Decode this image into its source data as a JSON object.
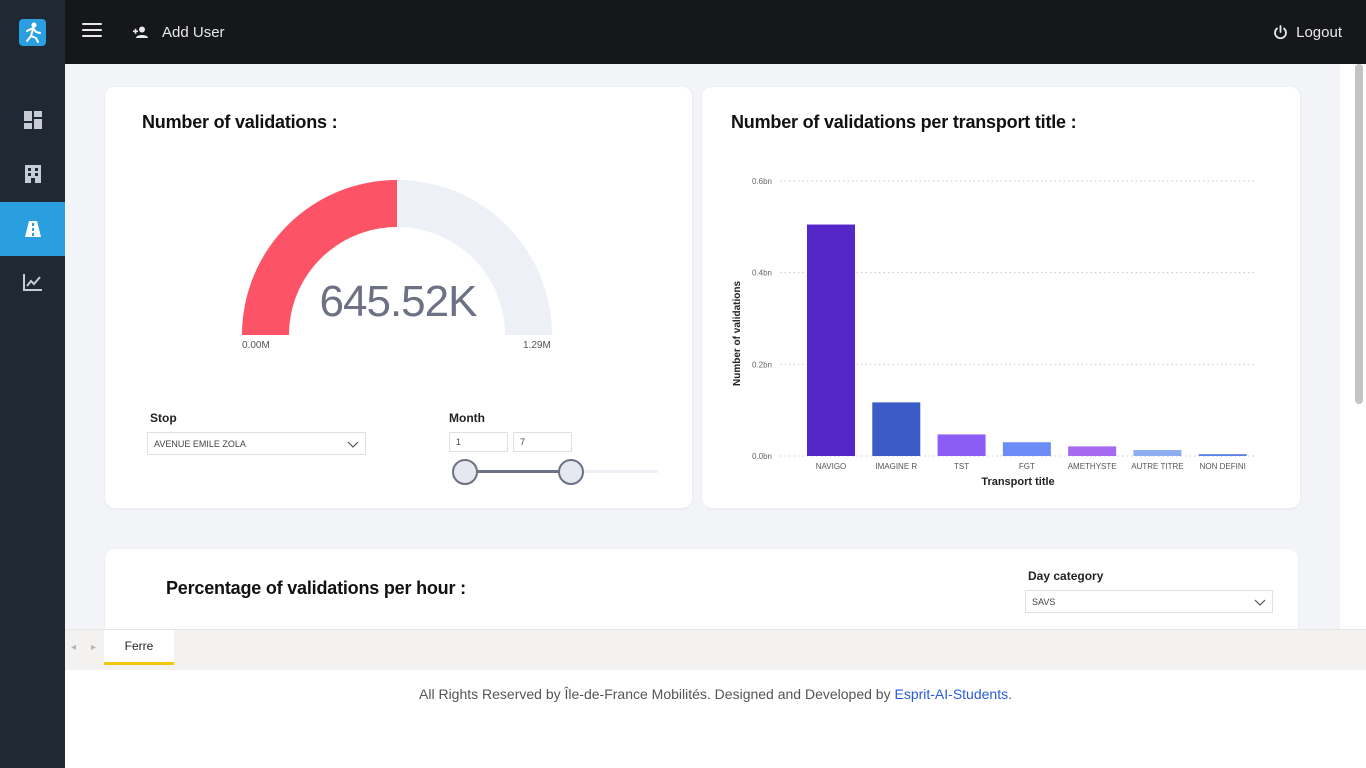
{
  "topbar": {
    "add_user_label": "Add User",
    "logout_label": "Logout"
  },
  "sidebar": {
    "items": [
      {
        "icon": "dashboard-icon",
        "active": false
      },
      {
        "icon": "building-icon",
        "active": false
      },
      {
        "icon": "road-icon",
        "active": true
      },
      {
        "icon": "line-chart-icon",
        "active": false
      }
    ]
  },
  "gauge_card": {
    "title": "Number of validations :",
    "value": "645.52K",
    "min_label": "0.00M",
    "max_label": "1.29M",
    "fill_fraction": 0.5,
    "fill_color": "#fd5366",
    "track_color": "#edf0f7",
    "stop_label": "Stop",
    "stop_value": "AVENUE EMILE ZOLA",
    "month_label": "Month",
    "month_from": "1",
    "month_to": "7"
  },
  "chart_card": {
    "title": "Number of validations per transport title :"
  },
  "chart_data": {
    "type": "bar",
    "xlabel": "Transport title",
    "ylabel": "Number of validations",
    "categories": [
      "NAVIGO",
      "IMAGINE R",
      "TST",
      "FGT",
      "AMETHYSTE",
      "AUTRE TITRE",
      "NON DEFINI"
    ],
    "values": [
      0.505,
      0.117,
      0.047,
      0.03,
      0.021,
      0.013,
      0.004
    ],
    "colors": [
      "#5527c8",
      "#3b5bc6",
      "#8b5cf6",
      "#6b8df5",
      "#a56af0",
      "#8eaef4",
      "#5b7fe8"
    ],
    "ylim": [
      0,
      0.6
    ],
    "yticks": [
      "0.0bn",
      "0.2bn",
      "0.4bn",
      "0.6bn"
    ],
    "grid": true
  },
  "hour_card": {
    "title": "Percentage of validations per hour :",
    "day_label": "Day category",
    "day_value": "SAVS"
  },
  "tabs": {
    "page_tab": "Ferre"
  },
  "footer": {
    "text_before": "All Rights Reserved by Île-de-France Mobilités. Designed and Developed by ",
    "link_text": "Esprit-AI-Students",
    "text_after": "."
  }
}
